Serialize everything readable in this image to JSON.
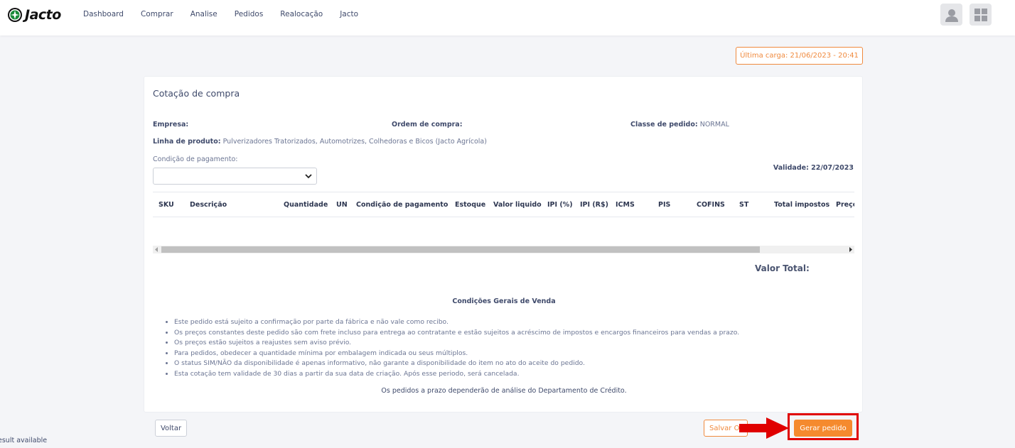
{
  "brand": {
    "name": "Jacto"
  },
  "nav": {
    "items": [
      "Dashboard",
      "Comprar",
      "Analise",
      "Pedidos",
      "Realocação",
      "Jacto"
    ]
  },
  "header": {
    "user_icon": "user-avatar-icon",
    "apps_icon": "grid-apps-icon"
  },
  "last_load": "Última carga: 21/06/2023 - 20:41",
  "card": {
    "title": "Cotação de compra",
    "empresa_label": "Empresa:",
    "empresa_value": "",
    "ordem_label": "Ordem de compra:",
    "ordem_value": "",
    "classe_label": "Classe de pedido:",
    "classe_value": "NORMAL",
    "linha_label": "Linha de produto:",
    "linha_value": "Pulverizadores Tratorizados, Automotrizes, Colhedoras e Bicos (Jacto Agrícola)",
    "pagamento_label": "Condição de pagamento:",
    "pagamento_value": "",
    "validade": "Validade: 22/07/2023",
    "table_columns": [
      "SKU",
      "Descrição",
      "Quantidade",
      "UN",
      "Condição de pagamento",
      "Estoque",
      "Valor liquido",
      "IPI (%)",
      "IPI (R$)",
      "ICMS",
      "PIS",
      "COFINS",
      "ST",
      "Total impostos",
      "Preço"
    ],
    "valor_total_label": "Valor Total:",
    "terms_title": "Condições Gerais de Venda",
    "terms": [
      "Este pedido está sujeito a confirmação por parte da fábrica e não vale como recibo.",
      "Os preços constantes deste pedido são com frete incluso para entrega ao contratante e estão sujeitos a acréscimo de impostos e encargos financeiros para vendas a prazo.",
      "Os preços estão sujeitos a reajustes sem aviso prévio.",
      "Para pedidos, obedecer a quantidade mínima por embalagem indicada ou seus múltiplos.",
      "O status SIM/NÃO da disponibilidade é apenas informativo, não garante a disponibilidade do item no ato do aceite do pedido.",
      "Esta cotação tem validade de 30 dias a partir da sua data de criação. Após esse periodo, será cancelada."
    ],
    "credit_note": "Os pedidos a prazo dependerão de análise do Departamento de Crédito."
  },
  "actions": {
    "back_label": "Voltar",
    "save_label": "Salvar Orçamento",
    "generate_label": "Gerar pedido"
  },
  "status_text": "esult available",
  "colors": {
    "accent": "#f58a2e",
    "highlight": "#e00000",
    "text": "#3f4a6b"
  }
}
